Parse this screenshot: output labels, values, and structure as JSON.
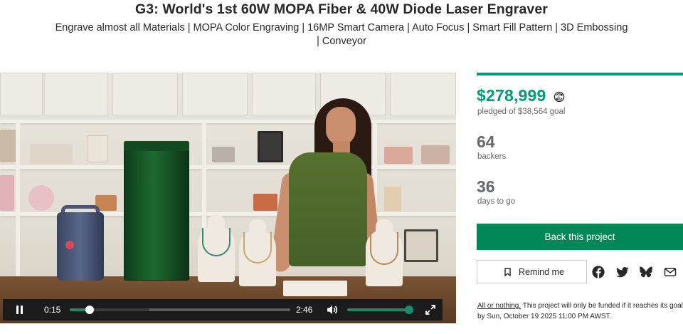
{
  "header": {
    "title": "G3: World's 1st 60W MOPA Fiber & 40W Diode Laser Engraver",
    "subtitle_line1": "Engrave almost all Materials | MOPA Color Engraving | 16MP Smart Camera | Auto Focus | Smart Fill Pattern | 3D Embossing",
    "subtitle_line2": "| Conveyor"
  },
  "video": {
    "current_time": "0:15",
    "total_time": "2:46",
    "progress_fraction": 0.09,
    "buffered_fraction": 0.36,
    "volume_fraction": 0.95
  },
  "campaign": {
    "pledged": "$278,999",
    "pledged_label": "pledged of $38,564 goal",
    "funded_fraction": 1.0,
    "backers_count": "64",
    "backers_label": "backers",
    "days_count": "36",
    "days_label": "days to go",
    "back_button": "Back this project",
    "remind_button": "Remind me",
    "aon_link": "All or nothing.",
    "aon_text": " This project will only be funded if it reaches its goal",
    "aon_deadline": "by Sun, October 19 2025 11:00 PM AWST."
  },
  "colors": {
    "accent_green": "#009e74",
    "button_green": "#028858",
    "text_dark": "#282828",
    "text_muted": "#656969"
  },
  "icons": {
    "currency": "currency-conversion-icon",
    "bookmark": "bookmark-icon",
    "share": [
      "facebook-icon",
      "twitter-icon",
      "bluesky-icon",
      "email-icon"
    ]
  }
}
